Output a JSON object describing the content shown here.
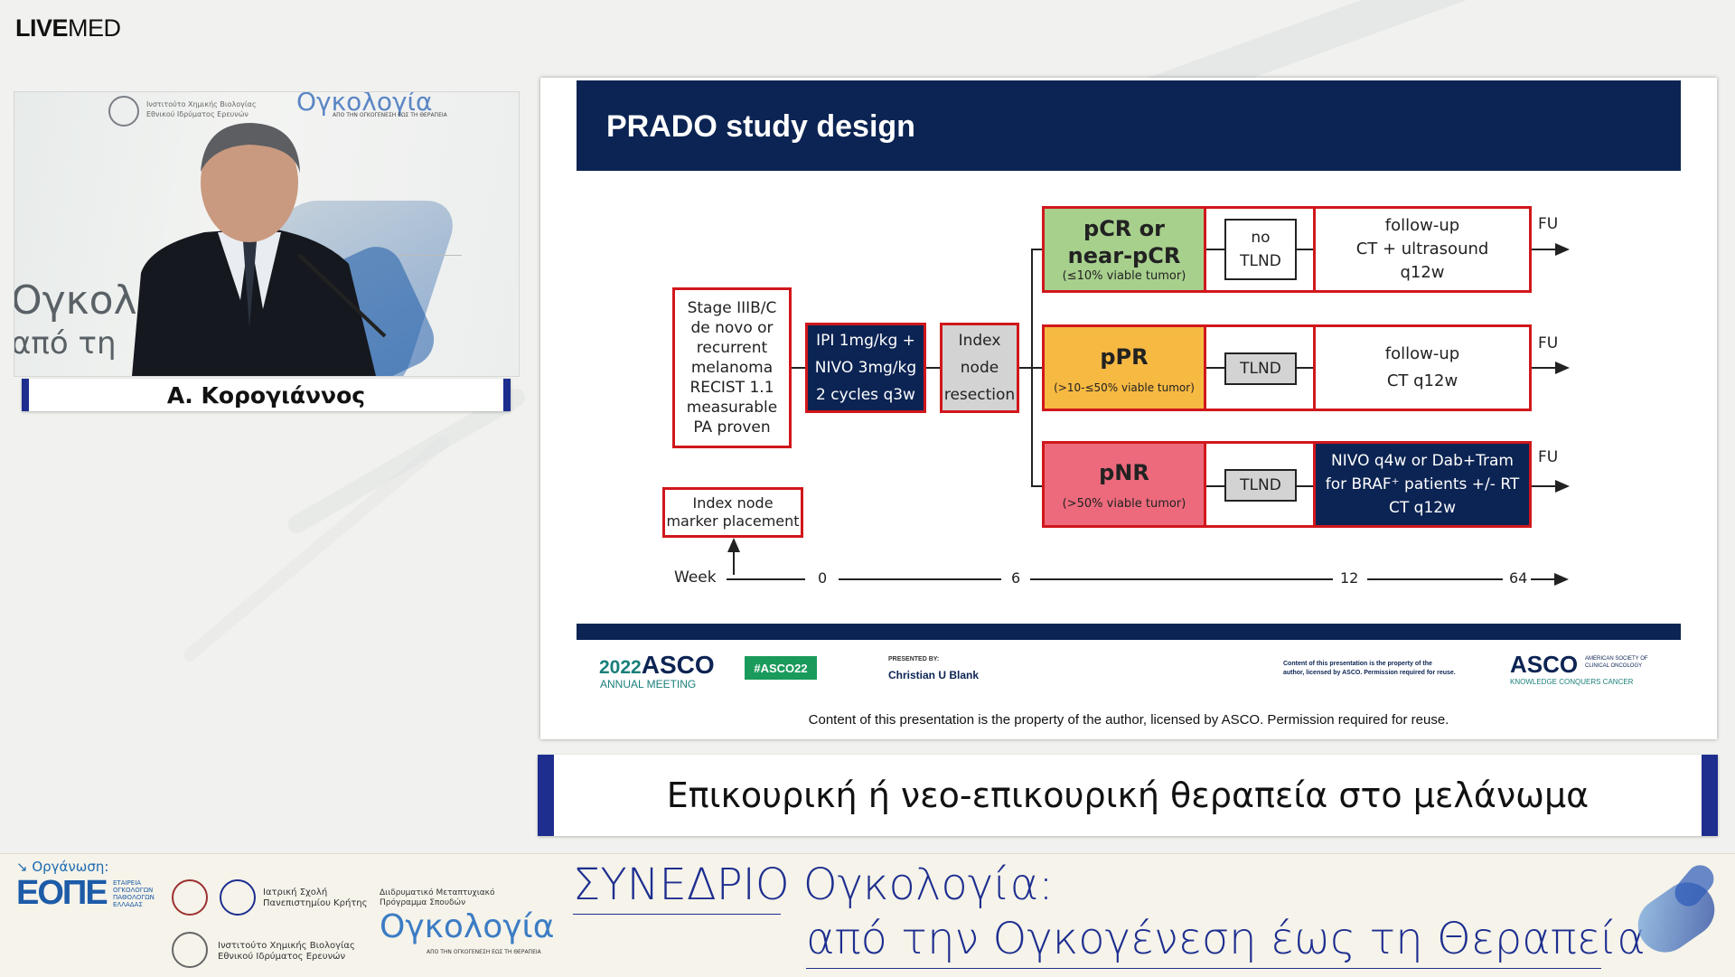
{
  "brand": {
    "bold": "LIVE",
    "thin": "MED"
  },
  "video": {
    "bg_text_1": "Ογκολ",
    "bg_text_2": "από τη",
    "institute_text": "Ινστιτούτο Χημικής Βιολογίας Εθνικού Ιδρύματος Ερευνών",
    "logo_text": "Ογκολογία",
    "logo_sub": "ΑΠΟ ΤΗΝ ΟΓΚΟΓΕΝΕΣΗ ΕΩΣ ΤΗ ΘΕΡΑΠΕΙΑ"
  },
  "speaker": {
    "name": "Α. Κορογιάννος"
  },
  "slide": {
    "title": "PRADO study design",
    "stage_box": [
      "Stage IIIB/C",
      "de novo or",
      "recurrent",
      "melanoma",
      "RECIST 1.1",
      "measurable",
      "PA proven"
    ],
    "treatment_box": [
      "IPI 1mg/kg +",
      "NIVO 3mg/kg",
      "2 cycles  q3w"
    ],
    "index_box": [
      "Index",
      "node",
      "resection"
    ],
    "marker_box": [
      "Index node",
      "marker placement"
    ],
    "rows": [
      {
        "label": [
          "pCR or",
          "near-pCR"
        ],
        "sub": "(≤10% viable tumor)",
        "proc": [
          "no",
          "TLND"
        ],
        "follow": [
          "follow-up",
          "CT + ultrasound",
          "q12w"
        ],
        "fu": "FU"
      },
      {
        "label": [
          "pPR"
        ],
        "sub": "(>10-≤50% viable tumor)",
        "proc": [
          "TLND"
        ],
        "follow": [
          "follow-up",
          "CT q12w"
        ],
        "fu": "FU"
      },
      {
        "label": [
          "pNR"
        ],
        "sub": "(>50% viable tumor)",
        "proc": [
          "TLND"
        ],
        "follow": [
          "NIVO q4w or Dab+Tram",
          "for BRAF⁺ patients +/- RT",
          "CT q12w"
        ],
        "fu": "FU"
      }
    ],
    "timeline": {
      "label": "Week",
      "ticks": [
        "0",
        "6",
        "12",
        "64"
      ]
    },
    "footer": {
      "asco_year": "2022",
      "asco_name": "ASCO",
      "asco_sub": "ANNUAL MEETING",
      "hashtag": "#ASCO22",
      "presented_by": "PRESENTED BY:",
      "presenter": "Christian U Blank",
      "rights_small_1": "Content of this presentation is the property of the",
      "rights_small_2": "author, licensed by ASCO. Permission required for reuse.",
      "asco_logo": "ASCO",
      "asco_logo_sub1": "AMERICAN SOCIETY OF",
      "asco_logo_sub2": "CLINICAL ONCOLOGY",
      "asco_tagline": "KNOWLEDGE CONQUERS CANCER",
      "rights_line": "Content of this presentation is the property of the author, licensed by ASCO. Permission required for reuse."
    }
  },
  "subtitle": "Επικουρική ή νεο-επικουρική θεραπεία στο μελάνωμα",
  "bottom": {
    "organizer_label": "↘ Οργάνωση:",
    "eope": "ΕΟΠΕ",
    "eope_sub": [
      "ΕΤΑΙΡΕΙΑ",
      "ΟΓΚΟΛΟΓΩΝ",
      "ΠΑΘΟΛΟΓΩΝ",
      "ΕΛΛΑΔΑΣ"
    ],
    "crete": [
      "Ιατρική Σχολή",
      "Πανεπιστημίου Κρήτης"
    ],
    "institute": [
      "Ινστιτούτο Χημικής Βιολογίας",
      "Εθνικού Ιδρύματος Ερευνών"
    ],
    "program": [
      "Διιδρυματικό Μεταπτυχιακό",
      "Πρόγραμμα Σπουδών"
    ],
    "program_logo": "Ογκολογία",
    "program_logo_sub": "ΑΠΟ ΤΗΝ ΟΓΚΟΓΕΝΕΣΗ ΕΩΣ ΤΗ ΘΕΡΑΠΕΙΑ",
    "conf_line1": "ΣΥΝΕΔΡΙΟ Ογκολογία:",
    "conf_line2": "από την Ογκογένεση έως τη Θεραπεία"
  },
  "colors": {
    "navy": "#0c2453",
    "red_border": "#d0171c",
    "green": "#a8d08d",
    "orange": "#f6b942",
    "pink": "#ec6a7c",
    "side_blue": "#1d2e8f",
    "asco_teal": "#1a7f7a"
  }
}
